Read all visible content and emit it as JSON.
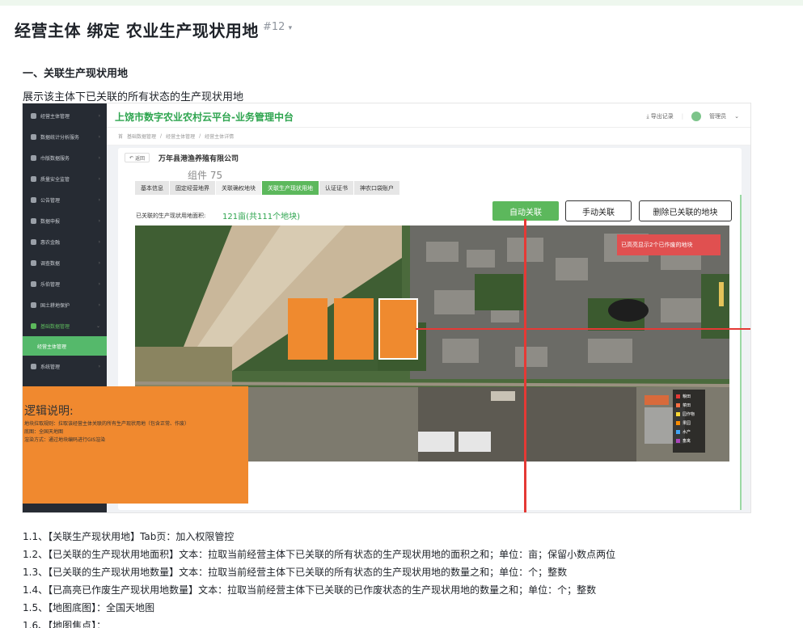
{
  "doc": {
    "title": "经营主体 绑定 农业生产现状用地",
    "badge": "#12",
    "badge_chevron": "chevron-down-icon",
    "section_heading": "一、关联生产现状用地",
    "section_desc": "展示该主体下已关联的所有状态的生产现状用地"
  },
  "app": {
    "title": "上饶市数字农业农村云平台-业务管理中台",
    "topbar": {
      "download_label": "导出记录",
      "user_name": "管理员"
    },
    "sidebar": {
      "items": [
        {
          "label": "经营主体管理",
          "icon": "building-icon"
        },
        {
          "label": "数据统计分析服务",
          "icon": "chart-icon"
        },
        {
          "label": "巾版数据服务",
          "icon": "data-icon"
        },
        {
          "label": "质量安全监管",
          "icon": "shield-icon"
        },
        {
          "label": "公告管理",
          "icon": "megaphone-icon"
        },
        {
          "label": "数据申报",
          "icon": "report-icon"
        },
        {
          "label": "惠农金融",
          "icon": "money-icon"
        },
        {
          "label": "调查数据",
          "icon": "survey-icon"
        },
        {
          "label": "乐伯管理",
          "icon": "manage-icon"
        },
        {
          "label": "国土耕地保护",
          "icon": "land-icon"
        },
        {
          "label": "基础数据管理",
          "icon": "database-icon"
        },
        {
          "label": "系统管理",
          "icon": "gear-icon"
        }
      ],
      "active_sub": "经营主体管理"
    },
    "breadcrumb": [
      "首",
      "基础数据管理",
      "经营主体管理",
      "经营主体详情"
    ],
    "card": {
      "back_label": "返回",
      "company": "万年县港渔养殖有限公司",
      "component_label": "组件 75",
      "tabs": [
        "基本信息",
        "固定经营地界",
        "关联确权地块",
        "关联生产现状用地",
        "认证证书",
        "神农口袋账户"
      ],
      "active_tab": 3,
      "area_label": "已关联的生产现状用地面积:",
      "area_value": "121亩(共111个地块)",
      "btn_auto": "自动关联",
      "btn_manual": "手动关联",
      "btn_delete": "删除已关联的地块",
      "red_banner": "已高亮显示2个已作废的地块",
      "legend": [
        {
          "label": "粮田",
          "color": "#e53935"
        },
        {
          "label": "菜田",
          "color": "#ff7043"
        },
        {
          "label": "园作物",
          "color": "#fdd835"
        },
        {
          "label": "果园",
          "color": "#fb8c00"
        },
        {
          "label": "水产",
          "color": "#42a5f5"
        },
        {
          "label": "畜禽",
          "color": "#ab47bc"
        }
      ]
    },
    "logic": {
      "title": "逻辑说明:",
      "lines": [
        "地块拉取规则：拉取该经营主体关联的所有生产现状用地（包含正常、作废）",
        "底图：全国天地图",
        "渲染方式：通过地块编码进行GIS渲染"
      ]
    }
  },
  "list": [
    "1.1、【关联生产现状用地】Tab页：加入权限管控",
    "1.2、【已关联的生产现状用地面积】文本：拉取当前经营主体下已关联的所有状态的生产现状用地的面积之和；单位：亩；保留小数点两位",
    "1.3、【已关联的生产现状用地数量】文本：拉取当前经营主体下已关联的所有状态的生产现状用地的数量之和；单位：个；整数",
    "1.4、【已高亮已作废生产现状用地数量】文本：拉取当前经营主体下已关联的已作废状态的生产现状用地的数量之和；单位：个；整数",
    "1.5、【地图底图】：全国天地图",
    "1.6、【地图焦点】："
  ],
  "colors": {
    "accent": "#5cb85c",
    "highlight": "#ef8a2f",
    "alert": "#e53935"
  }
}
